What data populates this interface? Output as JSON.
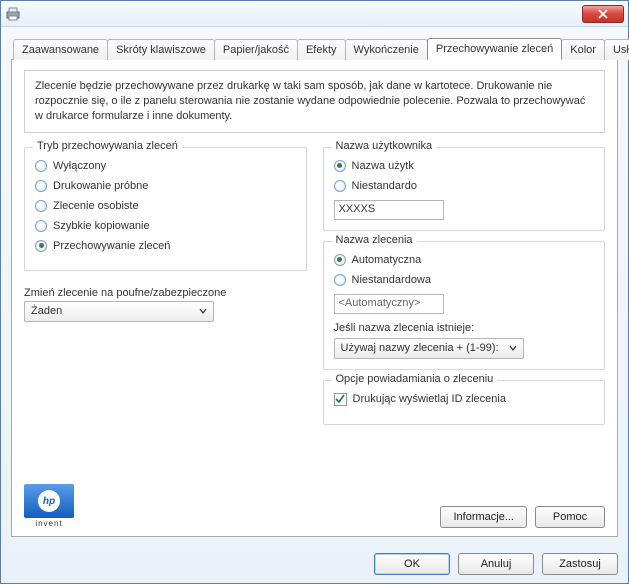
{
  "tabs": {
    "advanced": "Zaawansowane",
    "shortcuts": "Skróty klawiszowe",
    "paper": "Papier/jakość",
    "effects": "Efekty",
    "finishing": "Wykończenie",
    "storage": "Przechowywanie zleceń",
    "color": "Kolor",
    "services": "Usługi"
  },
  "info": "Zlecenie będzie przechowywane przez drukarkę w taki sam sposób, jak dane w kartotece. Drukowanie nie rozpocznie się, o ile z panelu sterowania nie zostanie wydane odpowiednie polecenie. Pozwala to przechowywać w drukarce formularze i inne dokumenty.",
  "storageMode": {
    "group": "Tryb przechowywania zleceń",
    "off": "Wyłączony",
    "proof": "Drukowanie próbne",
    "personal": "Zlecenie osobiste",
    "quick": "Szybkie kopiowanie",
    "stored": "Przechowywanie zleceń",
    "selected": "stored"
  },
  "confidential": {
    "label": "Zmień zlecenie na poufne/zabezpieczone",
    "value": "Żaden"
  },
  "userName": {
    "group": "Nazwa użytkownika",
    "optionUser": "Nazwa użytk",
    "optionCustom": "Niestandardo",
    "value": "XXXXS",
    "selected": "user"
  },
  "jobName": {
    "group": "Nazwa zlecenia",
    "optionAuto": "Automatyczna",
    "optionCustom": "Niestandardowa",
    "value": "<Automatyczny>",
    "existsLabel": "Jeśli nazwa zlecenia istnieje:",
    "existsValue": "Używaj nazwy zlecenia + (1-99):",
    "selected": "auto"
  },
  "notify": {
    "group": "Opcje powiadamiania o zleceniu",
    "showId": "Drukując wyświetlaj ID zlecenia",
    "checked": true
  },
  "buttons": {
    "info": "Informacje...",
    "help": "Pomoc",
    "ok": "OK",
    "cancel": "Anuluj",
    "apply": "Zastosuj"
  }
}
